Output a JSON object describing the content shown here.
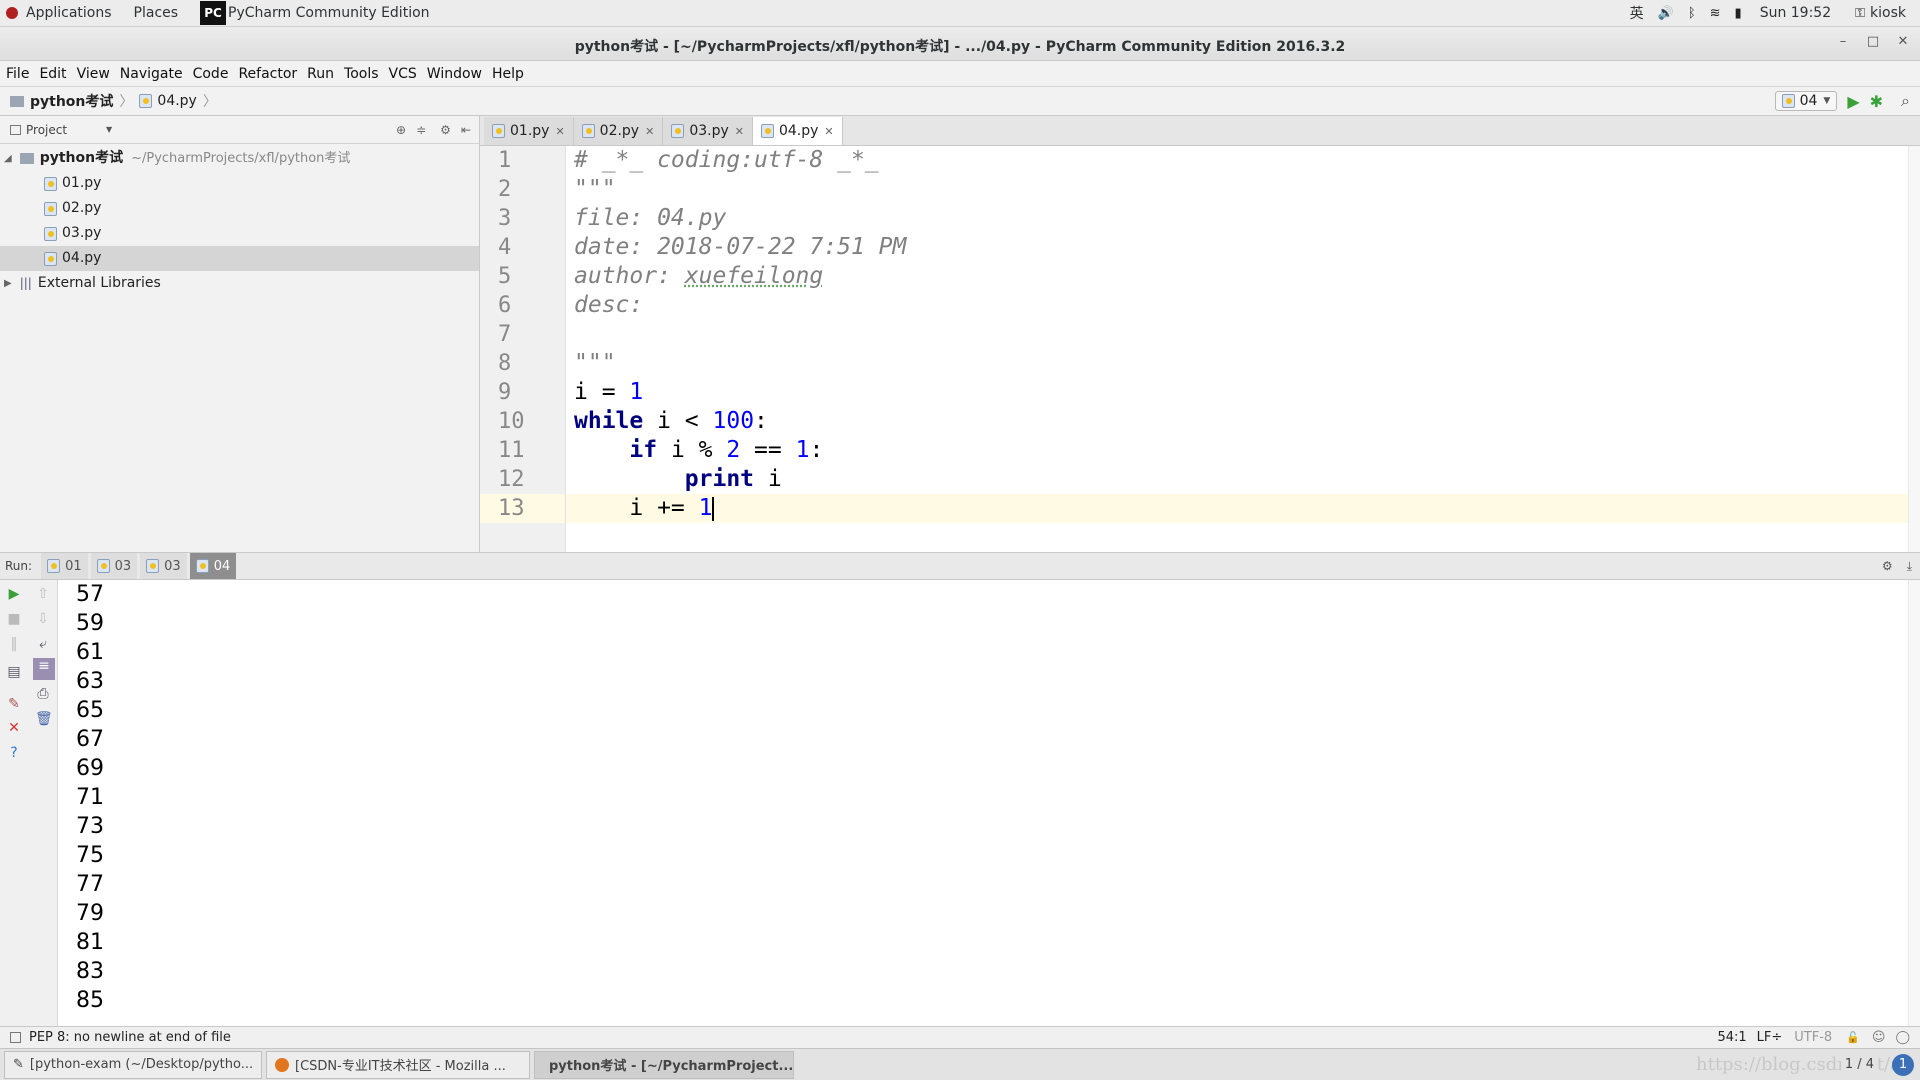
{
  "system_bar": {
    "applications": "Applications",
    "places": "Places",
    "active_app": "PyCharm Community Edition",
    "ime": "英",
    "clock": "Sun 19:52",
    "user": "kiosk"
  },
  "window": {
    "title": "python考试 - [~/PycharmProjects/xfl/python考试] - .../04.py - PyCharm Community Edition 2016.3.2"
  },
  "menu": [
    "File",
    "Edit",
    "View",
    "Navigate",
    "Code",
    "Refactor",
    "Run",
    "Tools",
    "VCS",
    "Window",
    "Help"
  ],
  "breadcrumb": {
    "project": "python考试",
    "file": "04.py"
  },
  "run_config": {
    "selected": "04"
  },
  "project_panel": {
    "header": "Project",
    "root": "python考试",
    "root_path": "~/PycharmProjects/xfl/python考试",
    "files": [
      "01.py",
      "02.py",
      "03.py",
      "04.py"
    ],
    "selected": "04.py",
    "external": "External Libraries"
  },
  "editor_tabs": [
    "01.py",
    "02.py",
    "03.py",
    "04.py"
  ],
  "editor_active_tab": "04.py",
  "code": {
    "line_numbers": [
      "1",
      "2",
      "3",
      "4",
      "5",
      "6",
      "7",
      "8",
      "9",
      "10",
      "11",
      "12",
      "13"
    ],
    "l1": "# _*_ coding:utf-8 _*_",
    "l2": "\"\"\"",
    "l3": "file: 04.py",
    "l4": "date: 2018-07-22 7:51 PM",
    "l5a": "author: ",
    "l5b": "xuefeilong",
    "l6": "desc:",
    "l8": "\"\"\"",
    "l9a": "i = ",
    "l9b": "1",
    "l10a": "while",
    "l10b": " i < ",
    "l10c": "100",
    "l10d": ":",
    "l11a": "    ",
    "l11b": "if",
    "l11c": " i % ",
    "l11d": "2",
    "l11e": " == ",
    "l11f": "1",
    "l11g": ":",
    "l12a": "        ",
    "l12b": "print",
    "l12c": " i",
    "l13a": "    i += ",
    "l13b": "1"
  },
  "run_panel": {
    "label": "Run:",
    "tabs": [
      "01",
      "03",
      "03",
      "04"
    ],
    "active": "04",
    "output": [
      "57",
      "59",
      "61",
      "63",
      "65",
      "67",
      "69",
      "71",
      "73",
      "75",
      "77",
      "79",
      "81",
      "83",
      "85"
    ]
  },
  "status": {
    "message": "PEP 8: no newline at end of file",
    "position": "54:1",
    "line_sep": "LF÷",
    "encoding": "UTF-8"
  },
  "taskbar": {
    "items": [
      "[python-exam (~/Desktop/pytho...",
      "[CSDN-专业IT技术社区 - Mozilla ...",
      "python考试 - [~/PycharmProject..."
    ],
    "pager": "1 / 4",
    "watermark": "https://blog.csdn.net/a"
  }
}
